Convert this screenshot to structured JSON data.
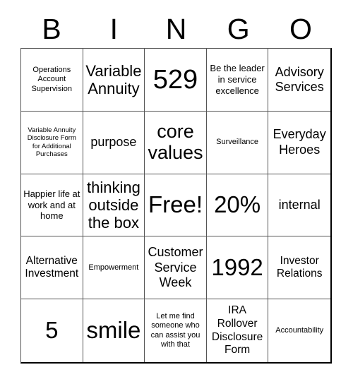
{
  "card": {
    "title": "BINGO",
    "columns": [
      "B",
      "I",
      "N",
      "G",
      "O"
    ],
    "free_space_label": "Free!",
    "grid_size": "5x5",
    "colors": {
      "background": "#ffffff",
      "text": "#000000",
      "grid_line": "#555555",
      "outer_border": "#000000"
    }
  },
  "header": {
    "letters": [
      {
        "label": "B"
      },
      {
        "label": "I"
      },
      {
        "label": "N"
      },
      {
        "label": "G"
      },
      {
        "label": "O"
      }
    ]
  },
  "rows": [
    {
      "cells": [
        {
          "label": "Operations Account Supervision",
          "size": "xs"
        },
        {
          "label": "Variable Annuity",
          "size": "xl"
        },
        {
          "label": "529",
          "size": "giant"
        },
        {
          "label": "Be the leader in service excellence",
          "size": "s"
        },
        {
          "label": "Advisory Services",
          "size": "l"
        }
      ]
    },
    {
      "cells": [
        {
          "label": "Variable Annuity Disclosure Form for Additional Purchases",
          "size": "xxs"
        },
        {
          "label": "purpose",
          "size": "l"
        },
        {
          "label": "core values",
          "size": "xxl"
        },
        {
          "label": "Surveillance",
          "size": "xs"
        },
        {
          "label": "Everyday Heroes",
          "size": "l"
        }
      ]
    },
    {
      "cells": [
        {
          "label": "Happier life at work and at home",
          "size": "s"
        },
        {
          "label": "thinking outside the box",
          "size": "xl"
        },
        {
          "label": "Free!",
          "size": "huge"
        },
        {
          "label": "20%",
          "size": "huge"
        },
        {
          "label": "internal",
          "size": "l"
        }
      ]
    },
    {
      "cells": [
        {
          "label": "Alternative Investment",
          "size": "m"
        },
        {
          "label": "Empowerment",
          "size": "xs"
        },
        {
          "label": "Customer Service Week",
          "size": "l"
        },
        {
          "label": "1992",
          "size": "huge"
        },
        {
          "label": "Investor Relations",
          "size": "m"
        }
      ]
    },
    {
      "cells": [
        {
          "label": "5",
          "size": "huge"
        },
        {
          "label": "smile",
          "size": "huge"
        },
        {
          "label": "Let me find someone who can assist you with that",
          "size": "xs"
        },
        {
          "label": "IRA Rollover Disclosure Form",
          "size": "m"
        },
        {
          "label": "Accountability",
          "size": "xs"
        }
      ]
    }
  ]
}
